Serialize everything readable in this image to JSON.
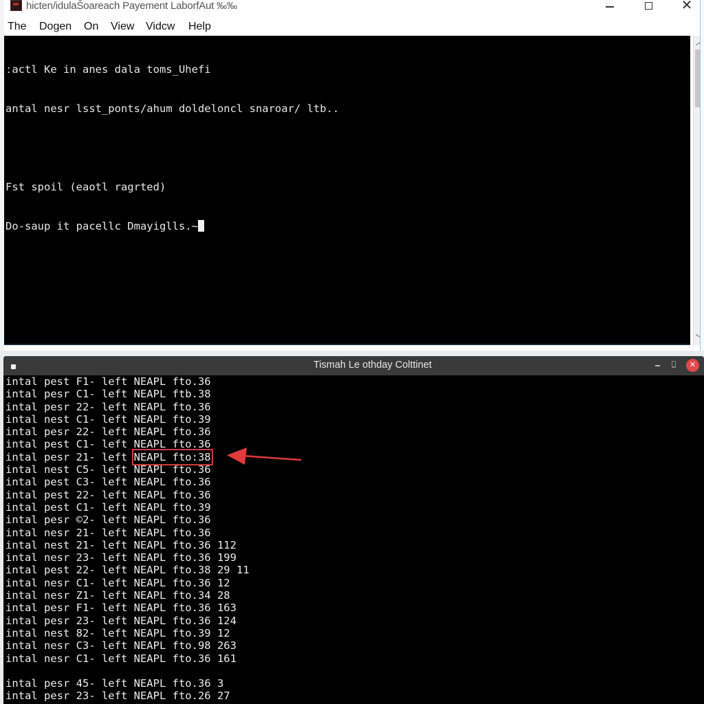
{
  "top_window": {
    "title": "hicten/idulaŠoareach Payement LaborfAut ‰‰",
    "app_icon": "terminal-app-icon",
    "controls": {
      "minimize": "minimize-icon",
      "maximize": "maximize-icon",
      "close": "close-icon"
    },
    "menu": [
      "The",
      "Dogen",
      "On",
      "View",
      "Vidcw",
      "Help"
    ],
    "console_lines": [
      "ːactl Ke in anes dala toms_Uhefi",
      "antal nesr lsst_ponts/ahum doldeloncl snaroar/ ltb..",
      "",
      "Fst spoil (eaotl ragrted)",
      "Do-saup it pacellc Dmayiglls.~"
    ],
    "scrollbar": {
      "up_arrow": "chevron-up-icon",
      "down_arrow": "chevron-down-icon"
    }
  },
  "bottom_window": {
    "title": "Tismah Le othday Colttinet",
    "controls": {
      "minimize": "minimize-icon",
      "maximize": "maximize-icon",
      "close": "close-icon"
    },
    "highlighted_row_index": 6,
    "highlighted_text": "NEAPL fto:38",
    "rows": [
      {
        "a": "intal",
        "b": "pest",
        "c": "F1-",
        "d": "left",
        "e": "NEAPL",
        "f": "fto.36",
        "g": ""
      },
      {
        "a": "intal",
        "b": "pesr",
        "c": "C1-",
        "d": "left",
        "e": "NEAPL",
        "f": "ftb.38",
        "g": ""
      },
      {
        "a": "intal",
        "b": "pesr",
        "c": "22-",
        "d": "left",
        "e": "NEAPL",
        "f": "fto.36",
        "g": ""
      },
      {
        "a": "intal",
        "b": "nest",
        "c": "C1-",
        "d": "left",
        "e": "NEAPL",
        "f": "fto.39",
        "g": ""
      },
      {
        "a": "intal",
        "b": "pesr",
        "c": "22-",
        "d": "left",
        "e": "NEAPL",
        "f": "fto.36",
        "g": ""
      },
      {
        "a": "intal",
        "b": "pest",
        "c": "C1-",
        "d": "left",
        "e": "NEAPL",
        "f": "fto.36",
        "g": ""
      },
      {
        "a": "intal",
        "b": "pesr",
        "c": "21-",
        "d": "left",
        "e": "NEAPL",
        "f": "fto:38",
        "g": ""
      },
      {
        "a": "intal",
        "b": "nest",
        "c": "C5-",
        "d": "left",
        "e": "NEAPL",
        "f": "fto.36",
        "g": ""
      },
      {
        "a": "intal",
        "b": "pest",
        "c": "C3-",
        "d": "left",
        "e": "NEAPL",
        "f": "fto.36",
        "g": ""
      },
      {
        "a": "intal",
        "b": "pest",
        "c": "22-",
        "d": "left",
        "e": "NEAPL",
        "f": "fto.36",
        "g": ""
      },
      {
        "a": "intal",
        "b": "pest",
        "c": "C1-",
        "d": "left",
        "e": "NEAPL",
        "f": "fto.39",
        "g": ""
      },
      {
        "a": "intal",
        "b": "pesr",
        "c": "©2-",
        "d": "left",
        "e": "NEAPL",
        "f": "fto.36",
        "g": ""
      },
      {
        "a": "intal",
        "b": "nesr",
        "c": "21-",
        "d": "left",
        "e": "NEAPL",
        "f": "fto.36",
        "g": ""
      },
      {
        "a": "intal",
        "b": "nest",
        "c": "21-",
        "d": "left",
        "e": "NEAPL",
        "f": "fto.36",
        "g": "112"
      },
      {
        "a": "intal",
        "b": "nesr",
        "c": "23-",
        "d": "left",
        "e": "NEAPL",
        "f": "fto.36",
        "g": "199"
      },
      {
        "a": "intal",
        "b": "pest",
        "c": "22-",
        "d": "left",
        "e": "NEAPL",
        "f": "fto.38",
        "g": "29 11"
      },
      {
        "a": "intal",
        "b": "nesr",
        "c": "C1-",
        "d": "left",
        "e": "NEAPL",
        "f": "fto.36",
        "g": "12"
      },
      {
        "a": "intal",
        "b": "nesr",
        "c": "Z1-",
        "d": "left",
        "e": "NEAPL",
        "f": "fto.34",
        "g": "28"
      },
      {
        "a": "intal",
        "b": "pesr",
        "c": "F1-",
        "d": "left",
        "e": "NEAPL",
        "f": "fto.36",
        "g": "163"
      },
      {
        "a": "intal",
        "b": "pesr",
        "c": "23-",
        "d": "left",
        "e": "NEAPL",
        "f": "fto.36",
        "g": "124"
      },
      {
        "a": "intal",
        "b": "nest",
        "c": "82-",
        "d": "left",
        "e": "NEAPL",
        "f": "fto.39",
        "g": "12"
      },
      {
        "a": "intal",
        "b": "nesr",
        "c": "C3-",
        "d": "left",
        "e": "NEAPL",
        "f": "fto.98",
        "g": "263"
      },
      {
        "a": "intal",
        "b": "nesr",
        "c": "C1-",
        "d": "left",
        "e": "NEAPL",
        "f": "fto.36",
        "g": "161"
      },
      null,
      {
        "a": "intal",
        "b": "pesr",
        "c": "45-",
        "d": "left",
        "e": "NEAPL",
        "f": "fto.36",
        "g": "3"
      },
      {
        "a": "intal",
        "b": "pesr",
        "c": "23-",
        "d": "left",
        "e": "NEAPL",
        "f": "fto.26",
        "g": "27"
      }
    ]
  },
  "annotation": {
    "arrow": "red-arrow-icon",
    "color": "#e03a3a"
  }
}
